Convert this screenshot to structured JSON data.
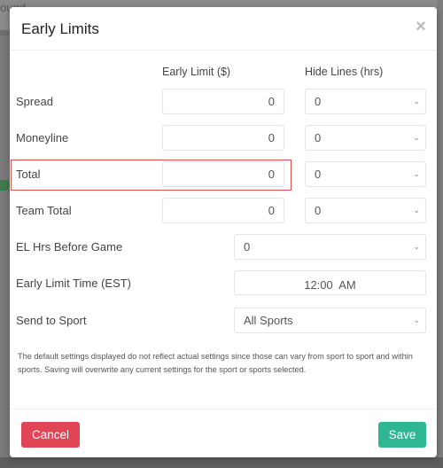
{
  "background": {
    "top_text": "ound"
  },
  "modal": {
    "title": "Early Limits",
    "close_glyph": "×",
    "columns": {
      "early_limit": "Early Limit ($)",
      "hide_lines": "Hide Lines (hrs)"
    },
    "rows": [
      {
        "label": "Spread",
        "early_limit": "0",
        "hide_lines": "0"
      },
      {
        "label": "Moneyline",
        "early_limit": "0",
        "hide_lines": "0"
      },
      {
        "label": "Total",
        "early_limit": "0",
        "hide_lines": "0",
        "highlighted": true
      },
      {
        "label": "Team Total",
        "early_limit": "0",
        "hide_lines": "0"
      }
    ],
    "el_hrs_before_game": {
      "label": "EL Hrs Before Game",
      "value": "0"
    },
    "early_limit_time": {
      "label": "Early Limit Time (EST)",
      "value": "12:00  AM"
    },
    "send_to_sport": {
      "label": "Send to Sport",
      "value": "All Sports"
    },
    "note": "The default settings displayed do not reflect actual settings since those can vary from sport to sport and within sports. Saving will overwrite any current settings for the sport or sports selected.",
    "buttons": {
      "cancel": "Cancel",
      "save": "Save"
    },
    "chevron_glyph": "⌄"
  },
  "colors": {
    "highlight": "#d9534f",
    "cancel": "#e04455",
    "save": "#2fb693"
  }
}
